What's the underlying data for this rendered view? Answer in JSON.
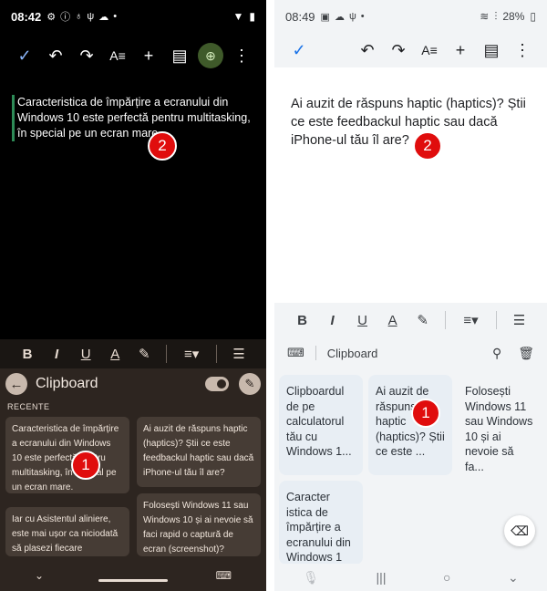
{
  "left": {
    "status": {
      "time": "08:42",
      "icons": [
        "settings-icon",
        "info-icon",
        "bulb-icon",
        "usb-icon",
        "cloud-icon",
        "dot"
      ],
      "right_icons": [
        "wifi-icon",
        "battery-icon"
      ]
    },
    "toolbar": {
      "check": "✓",
      "undo": "↶",
      "redo": "↷",
      "text_format": "A≡",
      "add": "+",
      "comment": "▤",
      "add_person": "⊕",
      "more": "⋮"
    },
    "doc_text": "Caracteristica de împărțire a ecranului din Windows 10 este perfectă pentru multitasking, în special pe un ecran mare.",
    "badge_doc": "2",
    "format": {
      "bold": "B",
      "italic": "I",
      "underline": "U",
      "text_color": "A",
      "highlight": "✎",
      "align": "≡▾",
      "list": "☰"
    },
    "clipboard": {
      "title": "Clipboard",
      "section": "RECENTE",
      "items": [
        "Caracteristica de împărțire a ecranului din Windows 10 este perfectă pentru multitasking, în special pe un ecran mare.",
        "Ai auzit de răspuns haptic (haptics)? Știi ce este feedbackul haptic sau dacă iPhone-ul tău îl are?",
        "Iar cu Asistentul aliniere, este mai ușor ca niciodată să plasezi fiecare",
        "Folosești Windows 11 sau Windows 10 și ai nevoie să faci rapid o captură de ecran (screenshot)?"
      ],
      "badge": "1"
    },
    "nav": {
      "down": "⌄",
      "keyboard": "⌨"
    }
  },
  "right": {
    "status": {
      "time": "08:49",
      "battery": "28%"
    },
    "toolbar": {
      "check": "✓",
      "undo": "↶",
      "redo": "↷",
      "text_format": "A≡",
      "add": "+",
      "comment": "▤",
      "more": "⋮"
    },
    "doc_text": "Ai auzit de răspuns haptic (haptics)? Știi ce este feedbackul haptic sau dacă iPhone-ul tău îl are?",
    "badge_doc": "2",
    "format": {
      "bold": "B",
      "italic": "I",
      "underline": "U",
      "text_color": "A",
      "highlight": "✎",
      "align": "≡▾",
      "list": "☰"
    },
    "clipboard": {
      "title": "Clipboard",
      "items": [
        "Clipboardul de pe calculatorul tău cu Windows 1...",
        "Ai auzit de răspuns haptic (haptics)? Știi ce este ...",
        "Folosești Windows 11 sau Windows 10 și ai nevoie să fa...",
        "Caracter istica de împărțire a ecranului din Windows 1"
      ],
      "badge": "1"
    },
    "nav": {
      "mic": "🎙",
      "recents": "|||",
      "home": "○",
      "back": "⌄",
      "backspace": "⌫"
    }
  },
  "colors": {
    "left_bg": "#000000",
    "left_clip_bg": "#2d2520",
    "left_accent": "#3f5a2a",
    "right_bg": "#ffffff",
    "right_clip_bg": "#e8eef4",
    "badge": "#e00d0d"
  }
}
